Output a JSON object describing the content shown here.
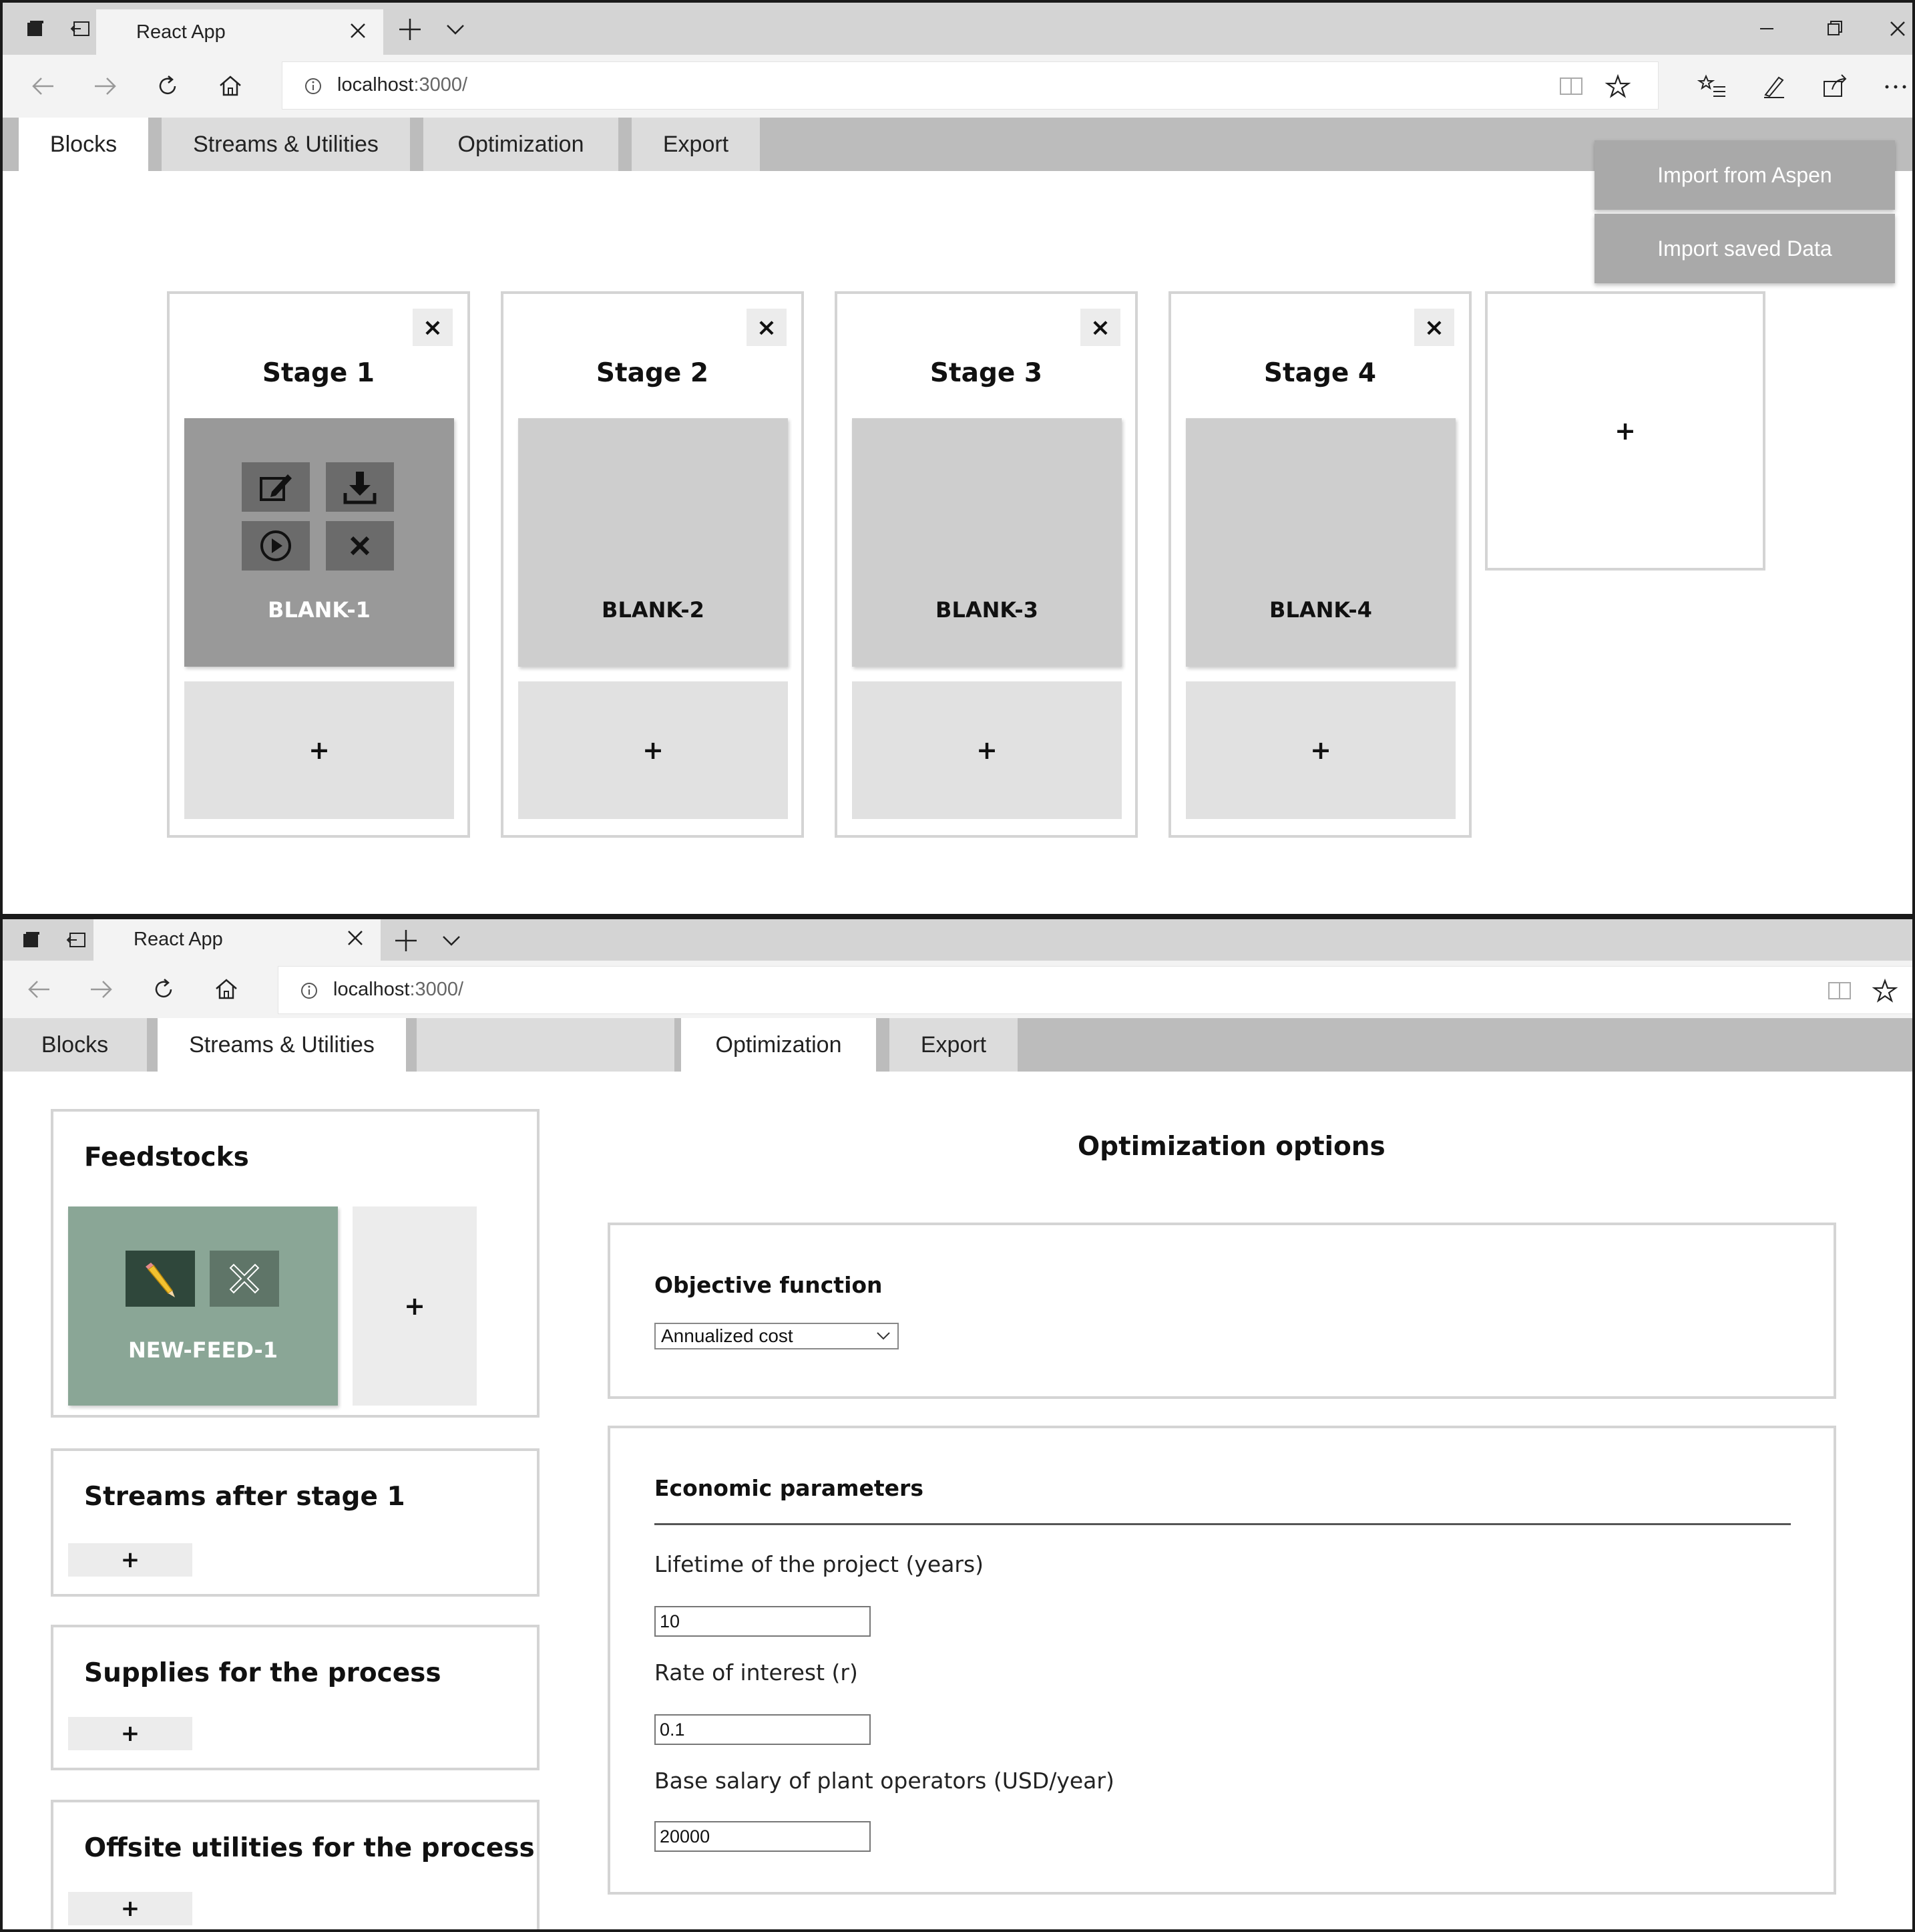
{
  "browser": {
    "tab_title": "React App",
    "url_host": "localhost",
    "url_port": ":3000/"
  },
  "app_tabs": {
    "blocks": "Blocks",
    "streams": "Streams & Utilities",
    "optimization": "Optimization",
    "export": "Export"
  },
  "blocks_page": {
    "import_aspen": "Import from Aspen",
    "import_saved": "Import saved Data",
    "stages": [
      {
        "title": "Stage 1",
        "block": "BLANK-1"
      },
      {
        "title": "Stage 2",
        "block": "BLANK-2"
      },
      {
        "title": "Stage 3",
        "block": "BLANK-3"
      },
      {
        "title": "Stage 4",
        "block": "BLANK-4"
      }
    ],
    "add_symbol": "+",
    "close_symbol": "×"
  },
  "streams_page": {
    "feedstocks_title": "Feedstocks",
    "feed_block": "NEW-FEED-1",
    "streams_after_title": "Streams after stage 1",
    "supplies_title": "Supplies for the process",
    "offsite_title": "Offsite utilities for the process",
    "add_symbol": "+"
  },
  "optimization_page": {
    "heading": "Optimization options",
    "objective_label": "Objective function",
    "objective_value": "Annualized cost",
    "economic_label": "Economic parameters",
    "lifetime_label": "Lifetime of the project (years)",
    "lifetime_value": "10",
    "interest_label": "Rate of interest (r)",
    "interest_value": "0.1",
    "salary_label": "Base salary of plant operators (USD/year)",
    "salary_value": "20000"
  },
  "colors": {
    "tab_bar": "#bcbcbc",
    "block_default": "#cecece",
    "block_hover": "#999999",
    "feed_block": "#8aa696",
    "import_button": "#a9a9a9"
  }
}
